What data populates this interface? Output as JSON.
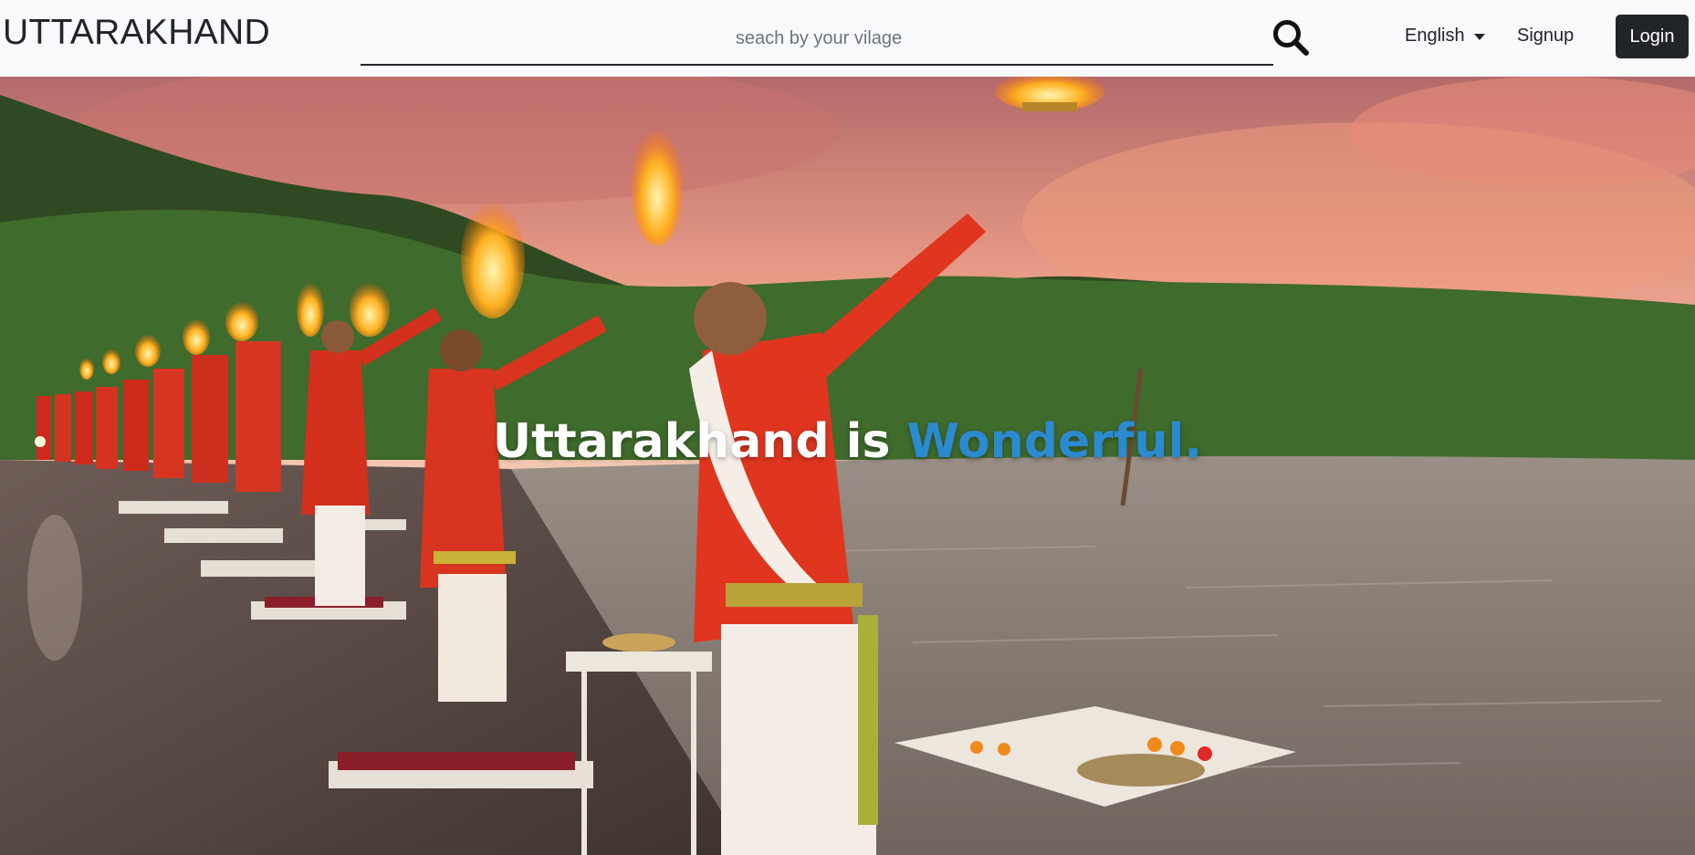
{
  "navbar": {
    "brand": "UTTARAKHAND",
    "search": {
      "placeholder": "seach by your vilage",
      "value": ""
    },
    "search_icon": "search-icon",
    "language": {
      "selected": "English"
    },
    "signup_label": "Signup",
    "login_label": "Login"
  },
  "hero": {
    "headline_prefix": "Uttarakhand is",
    "headline_accent": "Wonderful."
  },
  "colors": {
    "accent": "#2b8ad0",
    "navbar_bg": "#f8f9fa",
    "login_bg": "#212529"
  }
}
